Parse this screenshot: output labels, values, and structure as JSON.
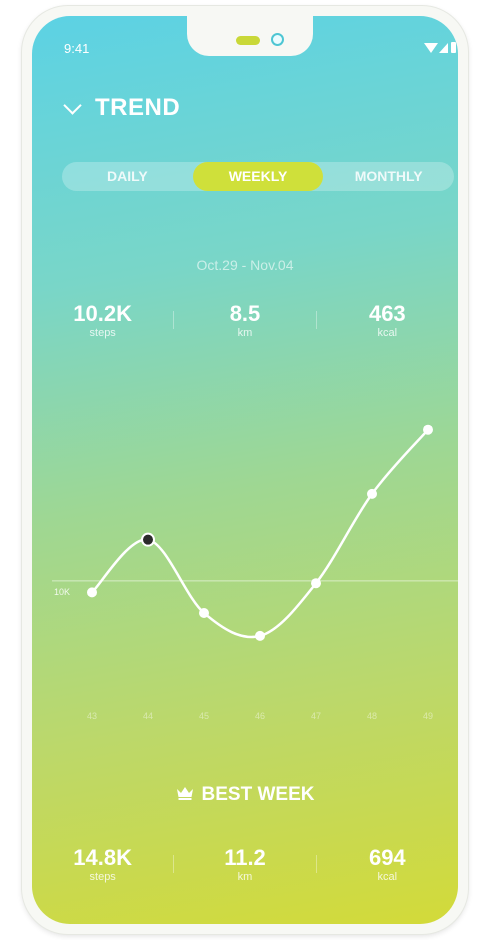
{
  "status_bar": {
    "time": "9:41"
  },
  "header": {
    "title": "TREND"
  },
  "period_tabs": [
    {
      "label": "DAILY",
      "active": false
    },
    {
      "label": "WEEKLY",
      "active": true
    },
    {
      "label": "MONTHLY",
      "active": false
    }
  ],
  "current": {
    "date_range": "Oct.29 - Nov.04",
    "stats": [
      {
        "value": "10.2K",
        "unit": "steps"
      },
      {
        "value": "8.5",
        "unit": "km"
      },
      {
        "value": "463",
        "unit": "kcal"
      }
    ]
  },
  "best_week": {
    "label": "BEST WEEK",
    "stats": [
      {
        "value": "14.8K",
        "unit": "steps"
      },
      {
        "value": "11.2",
        "unit": "km"
      },
      {
        "value": "694",
        "unit": "kcal"
      }
    ]
  },
  "chart_data": {
    "type": "line",
    "x": [
      "43",
      "44",
      "45",
      "46",
      "47",
      "48",
      "49"
    ],
    "series": [
      {
        "values": [
          9500,
          11800,
          8600,
          7600,
          9900,
          13800,
          16600
        ]
      }
    ],
    "selected_index": 1,
    "reference_line": {
      "value": 10000,
      "label": "10K"
    },
    "ylim": [
      0,
      22000
    ],
    "grid": false,
    "colors": {
      "line": "#ffffff",
      "selected_point": "#2b2b2b"
    }
  },
  "colors": {
    "active_tab": "#cfe03a",
    "gradient_top": "#5cd2e4",
    "gradient_bottom": "#d3da39"
  }
}
